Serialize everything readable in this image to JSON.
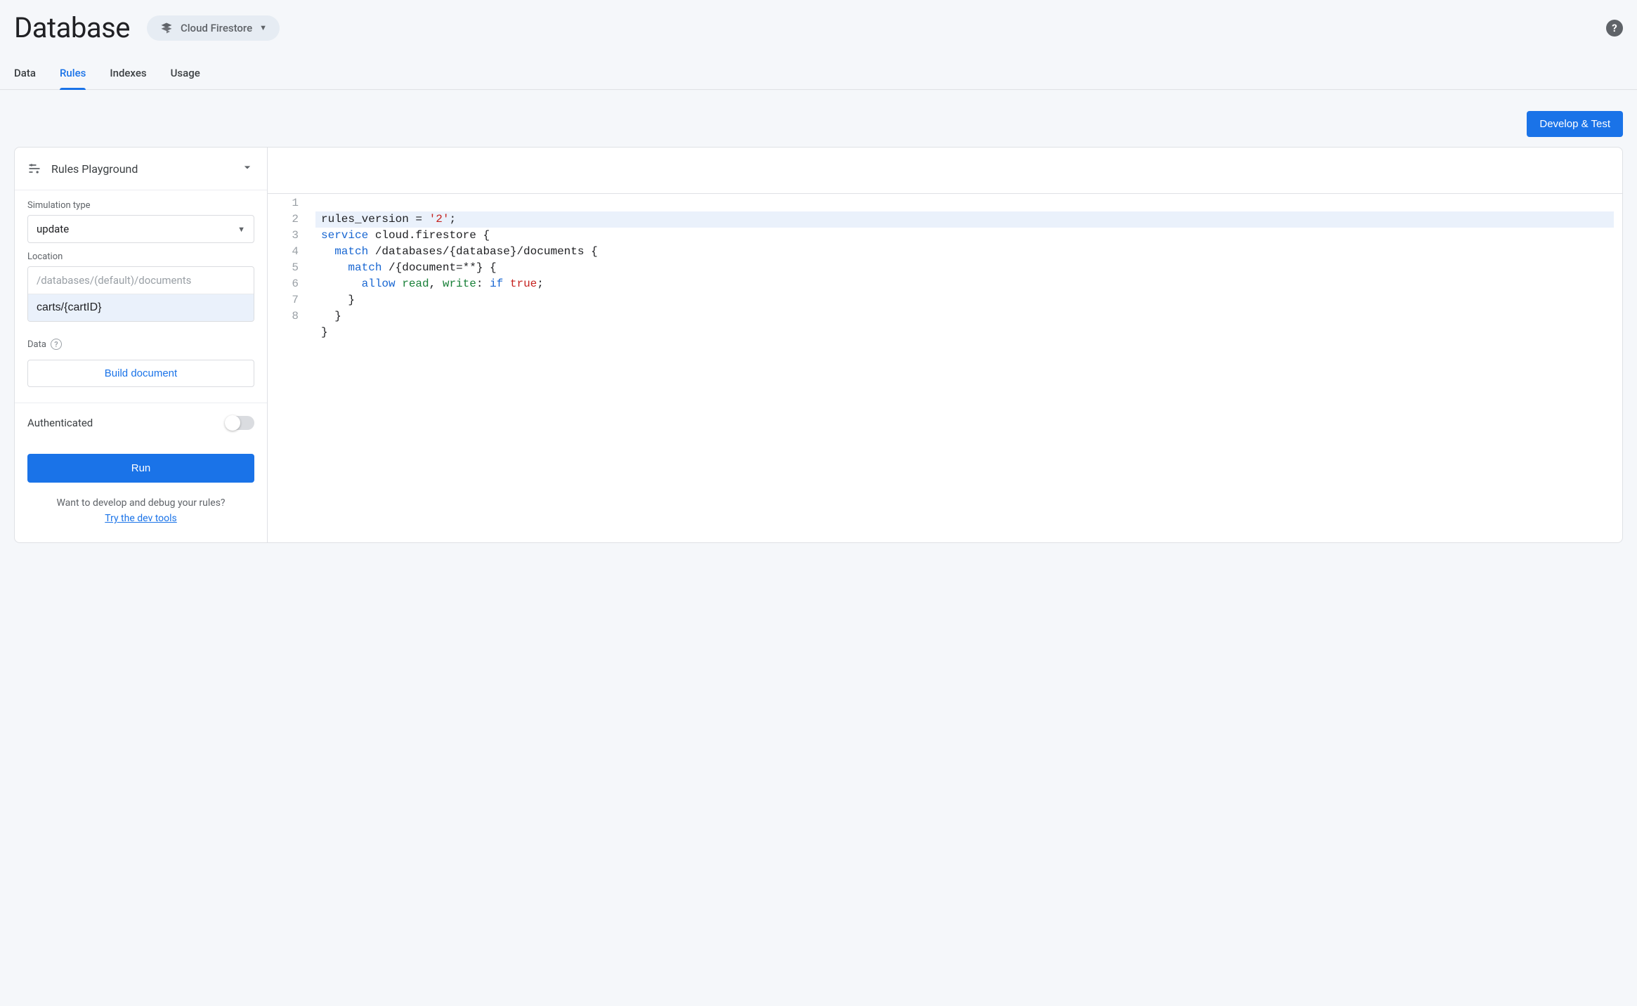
{
  "header": {
    "title": "Database",
    "selector_label": "Cloud Firestore"
  },
  "tabs": [
    {
      "label": "Data",
      "active": false
    },
    {
      "label": "Rules",
      "active": true
    },
    {
      "label": "Indexes",
      "active": false
    },
    {
      "label": "Usage",
      "active": false
    }
  ],
  "toolbar": {
    "develop_test_label": "Develop & Test"
  },
  "playground": {
    "title": "Rules Playground",
    "sim_type_label": "Simulation type",
    "sim_type_value": "update",
    "location_label": "Location",
    "location_prefix": "/databases/(default)/documents",
    "location_value": "carts/{cartID}",
    "data_label": "Data",
    "build_doc_label": "Build document",
    "authenticated_label": "Authenticated",
    "run_label": "Run",
    "footer_text": "Want to develop and debug your rules?",
    "footer_link": "Try the dev tools"
  },
  "editor": {
    "line_numbers": [
      "1",
      "2",
      "3",
      "4",
      "5",
      "6",
      "7",
      "8"
    ],
    "code": {
      "l1_a": "rules_version = ",
      "l1_b": "'2'",
      "l1_c": ";",
      "l2_a": "service",
      "l2_b": " cloud.firestore {",
      "l3_a": "  match",
      "l3_b": " /databases/{database}/documents {",
      "l4_a": "    match",
      "l4_b": " /{document=**} {",
      "l5_a": "      allow",
      "l5_b": " read",
      "l5_c": ", ",
      "l5_d": "write",
      "l5_e": ": ",
      "l5_f": "if",
      "l5_g": " ",
      "l5_h": "true",
      "l5_i": ";",
      "l6": "    }",
      "l7": "  }",
      "l8": "}"
    }
  }
}
